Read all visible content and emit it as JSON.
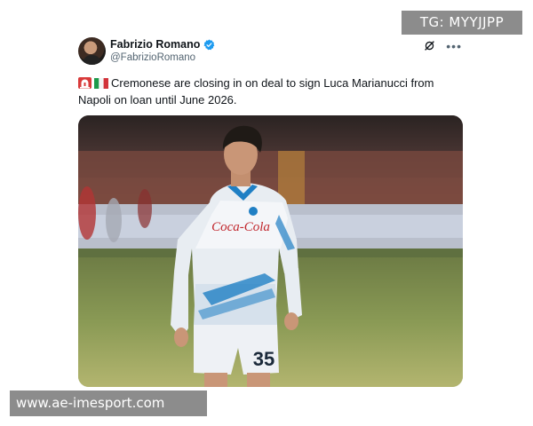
{
  "watermark_top": "TG: MYYJJPP",
  "tweet": {
    "author_name": "Fabrizio Romano",
    "author_handle": "@FabrizioRomano",
    "text": "Cremonese are closing in on deal to sign Luca Marianucci from Napoli on loan until June 2026.",
    "photo": {
      "shirt_sponsor": "Coca-Cola",
      "shirt_number": "35"
    }
  },
  "colors": {
    "verified": "#1d9bf0",
    "napoli_blue": "#1f7fc4"
  },
  "watermark_bottom": "www.ae-imesport.com"
}
